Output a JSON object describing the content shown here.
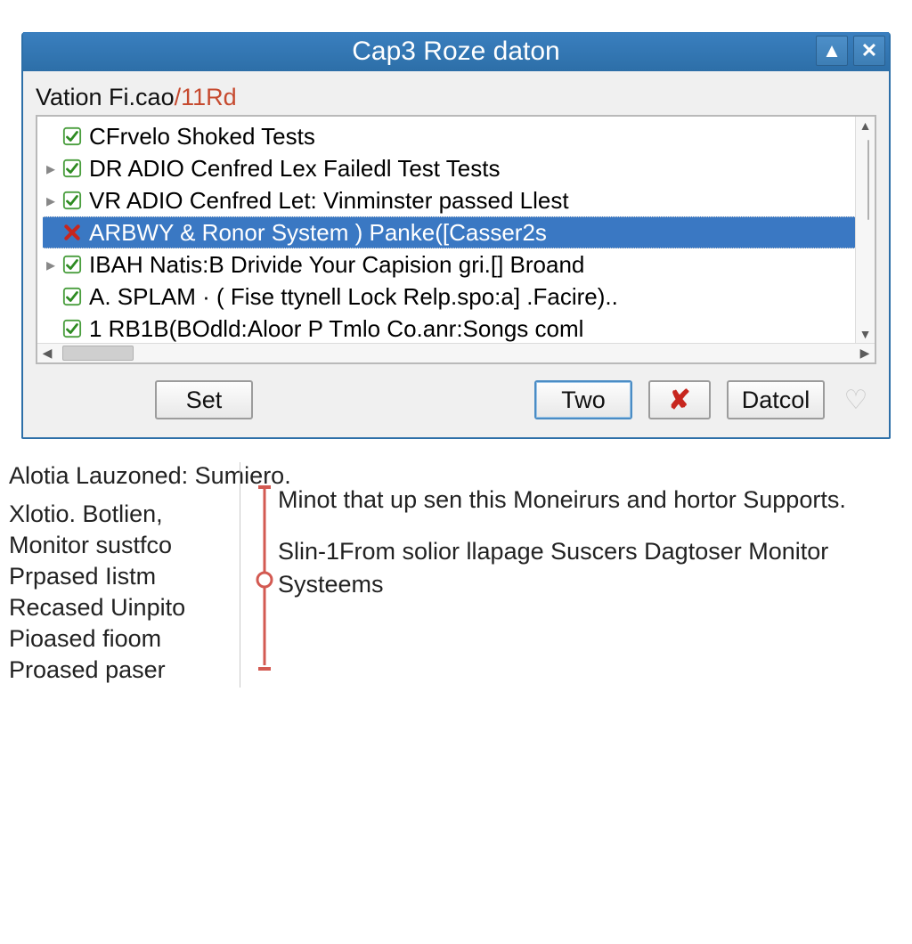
{
  "window": {
    "title": "Cap3 Roze daton"
  },
  "pane": {
    "label_prefix": "Vation Fi.cao",
    "label_suffix": "/11Rd"
  },
  "items": [
    {
      "status": "pass",
      "expander": "",
      "text": "CFrvelo Shoked Tests",
      "selected": false
    },
    {
      "status": "pass",
      "expander": "▸",
      "text": "DR ADIO Cenfred Lex Failedl Test Tests",
      "selected": false
    },
    {
      "status": "pass",
      "expander": "▸",
      "text": "VR ADIO Cenfred Let: Vinminster passed Llest",
      "selected": false
    },
    {
      "status": "fail",
      "expander": "",
      "text": "ARBWY & Ronor System ) Panke([Casser2s",
      "selected": true
    },
    {
      "status": "pass",
      "expander": "▸",
      "text": "IBAH Natis:B Drivide Your Capision gri.[] Broand",
      "selected": false
    },
    {
      "status": "pass",
      "expander": "",
      "text": "A. SPLAM · ( Fise ttynell Lock Relp.spo:a] .Facire)..",
      "selected": false
    },
    {
      "status": "pass",
      "expander": "",
      "text": "1 RB1B(BOdld:Aloor P Tmlo Co.anr:Songs coml",
      "selected": false
    }
  ],
  "buttons": {
    "set": "Set",
    "two": "Two",
    "datcol": "Datcol"
  },
  "lower": {
    "headline": "Alotia Lauzoned: Sumiero.",
    "lines": [
      "Xlotio. Botlien,",
      "Monitor sustfco",
      "Prpased Iistm",
      "Recased Uinpito",
      "Pioased fioom",
      "Proased paser"
    ],
    "right": {
      "p1": "Minot that up sen this Moneirurs and hortor Supports.",
      "p2": "Slin-1From solior llapage Suscers Dagtoser Monitor Systeems"
    }
  }
}
